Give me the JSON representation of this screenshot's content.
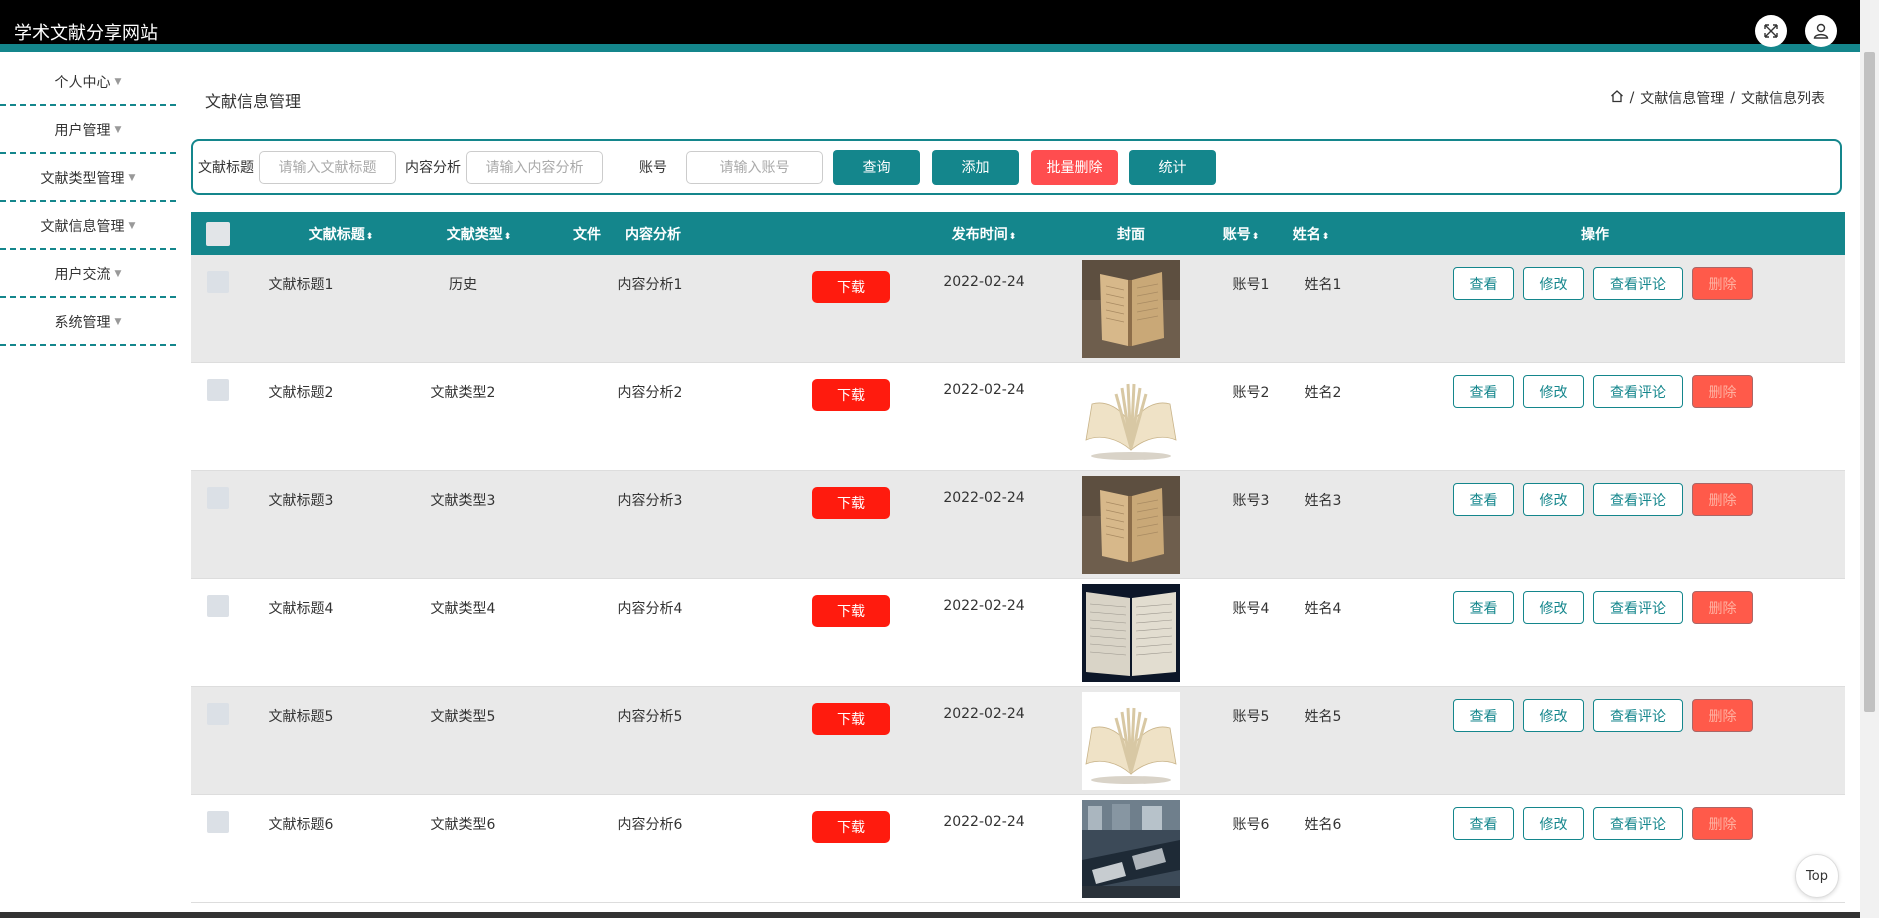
{
  "header": {
    "title": "学术文献分享网站",
    "icons": [
      "fullscreen-icon",
      "user-icon"
    ]
  },
  "sidebar": {
    "items": [
      {
        "label": "个人中心"
      },
      {
        "label": "用户管理"
      },
      {
        "label": "文献类型管理"
      },
      {
        "label": "文献信息管理"
      },
      {
        "label": "用户交流"
      },
      {
        "label": "系统管理"
      }
    ]
  },
  "page": {
    "title": "文献信息管理",
    "breadcrumb": [
      "文献信息管理",
      "文献信息列表"
    ],
    "separator": "/"
  },
  "search": {
    "title_label": "文献标题",
    "title_placeholder": "请输入文献标题",
    "content_label": "内容分析",
    "content_placeholder": "请输入内容分析",
    "account_label": "账号",
    "account_placeholder": "请输入账号",
    "query_button": "查询",
    "add_button": "添加",
    "batch_delete_button": "批量删除",
    "stats_button": "统计"
  },
  "table": {
    "headers": {
      "title": "文献标题",
      "type": "文献类型",
      "content": "内容分析",
      "file": "文件",
      "date": "发布时间",
      "cover": "封面",
      "account": "账号",
      "name": "姓名",
      "ops": "操作"
    },
    "rows": [
      {
        "title": "文献标题1",
        "type": "历史",
        "content": "内容分析1",
        "file": "下载",
        "date": "2022-02-24",
        "account": "账号1",
        "name": "姓名1",
        "cover": "old-book"
      },
      {
        "title": "文献标题2",
        "type": "文献类型2",
        "content": "内容分析2",
        "file": "下载",
        "date": "2022-02-24",
        "account": "账号2",
        "name": "姓名2",
        "cover": "open-book"
      },
      {
        "title": "文献标题3",
        "type": "文献类型3",
        "content": "内容分析3",
        "file": "下载",
        "date": "2022-02-24",
        "account": "账号3",
        "name": "姓名3",
        "cover": "old-book"
      },
      {
        "title": "文献标题4",
        "type": "文献类型4",
        "content": "内容分析4",
        "file": "下载",
        "date": "2022-02-24",
        "account": "账号4",
        "name": "姓名4",
        "cover": "dark-book"
      },
      {
        "title": "文献标题5",
        "type": "文献类型5",
        "content": "内容分析5",
        "file": "下载",
        "date": "2022-02-24",
        "account": "账号5",
        "name": "姓名5",
        "cover": "open-book"
      },
      {
        "title": "文献标题6",
        "type": "文献类型6",
        "content": "内容分析6",
        "file": "下载",
        "date": "2022-02-24",
        "account": "账号6",
        "name": "姓名6",
        "cover": "library"
      }
    ],
    "actions": {
      "view": "查看",
      "edit": "修改",
      "comments": "查看评论",
      "delete": "删除"
    }
  },
  "top_button": "Top",
  "colors": {
    "accent": "#14868c",
    "danger": "#ff4d4f",
    "download": "#ff1b0e"
  }
}
